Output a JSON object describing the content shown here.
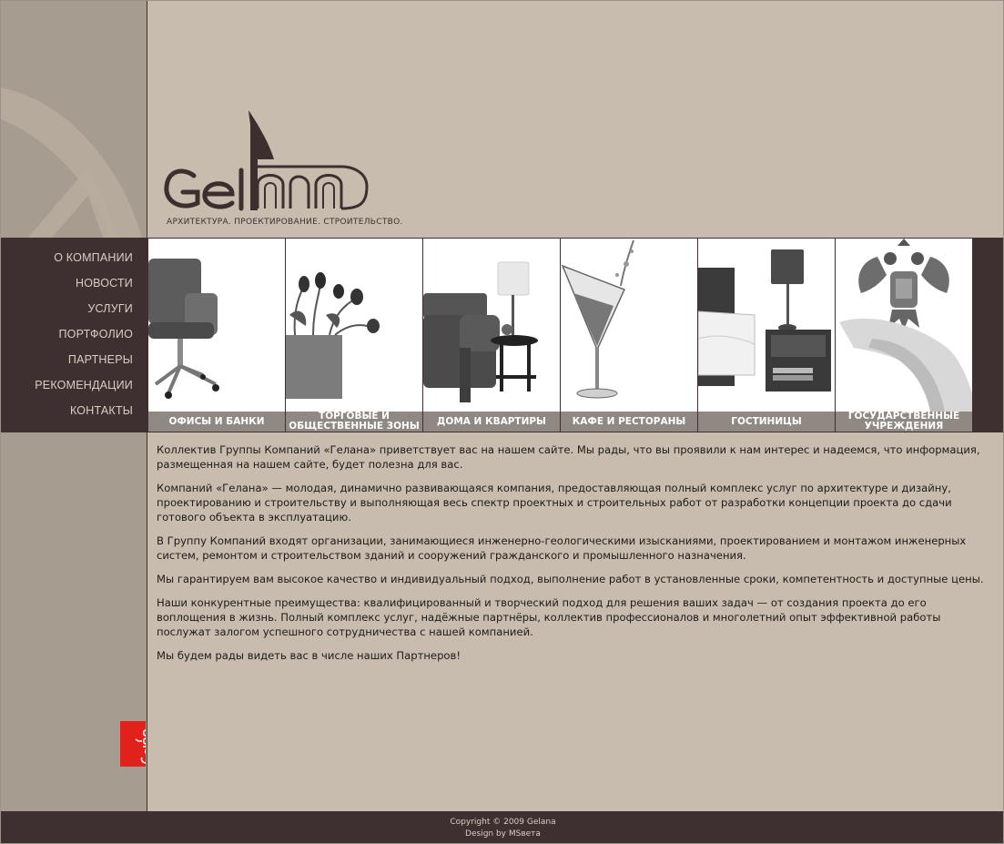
{
  "brand": {
    "logo_text": "Gelana",
    "tagline": "АРХИТЕКТУРА. ПРОЕКТИРОВАНИЕ. СТРОИТЕЛЬСТВО."
  },
  "nav": {
    "items": [
      {
        "label": "О КОМПАНИИ"
      },
      {
        "label": "НОВОСТИ"
      },
      {
        "label": "УСЛУГИ"
      },
      {
        "label": "ПОРТФОЛИО"
      },
      {
        "label": "ПАРТНЕРЫ"
      },
      {
        "label": "РЕКОМЕНДАЦИИ"
      },
      {
        "label": "КОНТАКТЫ"
      }
    ]
  },
  "tiles": [
    {
      "caption": "ОФИСЫ И БАНКИ",
      "icon": "office-chair-icon"
    },
    {
      "caption": "ТОРГОВЫЕ И ОБЩЕСТВЕННЫЕ ЗОНЫ",
      "icon": "tulips-vase-icon"
    },
    {
      "caption": "ДОМА И КВАРТИРЫ",
      "icon": "armchair-lamp-icon"
    },
    {
      "caption": "КАФЕ И РЕСТОРАНЫ",
      "icon": "cocktail-glass-icon"
    },
    {
      "caption": "ГОСТИНИЦЫ",
      "icon": "hotel-bed-icon"
    },
    {
      "caption": "ГОСУДАРСТВЕННЫЕ УЧРЕЖДЕНИЯ",
      "icon": "coat-of-arms-icon"
    }
  ],
  "content": {
    "paragraphs": [
      "Коллектив Группы Компаний «Гелана» приветствует вас на нашем сайте. Мы рады, что вы проявили к нам интерес и надеемся, что информация, размещенная на нашем сайте, будет полезна для вас.",
      "Компаний «Гелана» — молодая, динамично развивающаяся компания, предоставляющая полный комплекс услуг по архитектуре и дизайну, проектированию и строительству и выполняющая весь спектр проектных и строительных работ от разработки концепции проекта до сдачи готового объекта в эксплуатацию.",
      "В Группу Компаний входят организации, занимающиеся инженерно-геологическими изысканиями, проектированием и монтажом инженерных систем, ремонтом и строительством зданий и сооружений гражданского и промышленного назначения.",
      "Мы гарантируем вам высокое качество и индивидуальный подход, выполнение работ в установленные сроки, компетентность и доступные цены.",
      "Наши конкурентные преимущества: квалифицированный и творческий подход для решения ваших задач — от создания проекта до его воплощения в жизнь. Полный комплекс услуг, надёжные партнёры, коллектив профессионалов и многолетний опыт эффективной работы послужат залогом успешного сотрудничества с нашей компанией.",
      "Мы будем рады видеть вас в числе наших Партнеров!"
    ]
  },
  "footer": {
    "copyright": "Copyright © 2009 Gelana",
    "design": "Design by MSвета"
  },
  "colors": {
    "beige": "#c7bcad",
    "sidebar": "#a69c8f",
    "dark": "#3e3030",
    "caption_bar": "#8f8883",
    "badge_red": "#e0211c"
  }
}
